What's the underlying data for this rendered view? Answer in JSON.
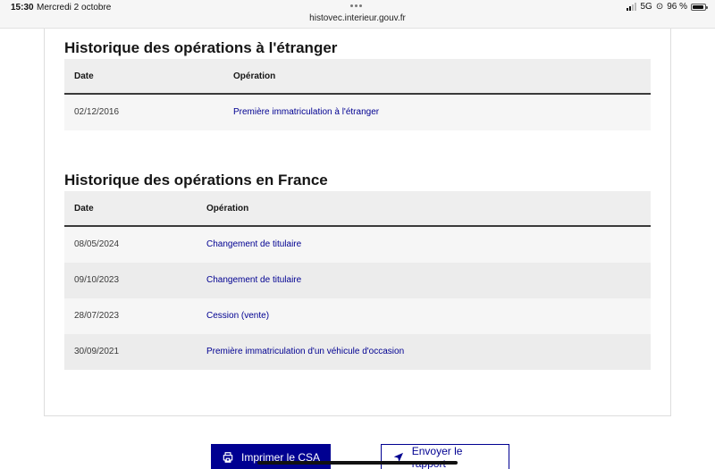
{
  "status_bar": {
    "time": "15:30",
    "date": "Mercredi 2 octobre",
    "url": "histovec.interieur.gouv.fr",
    "network": "5G",
    "battery": "96 %",
    "battery_level": 0.96
  },
  "abroad": {
    "title": "Historique des opérations à l'étranger",
    "col_date": "Date",
    "col_operation": "Opération",
    "rows": [
      {
        "date": "02/12/2016",
        "operation": "Première immatriculation à l'étranger"
      }
    ]
  },
  "france": {
    "title": "Historique des opérations en France",
    "col_date": "Date",
    "col_operation": "Opération",
    "rows": [
      {
        "date": "08/05/2024",
        "operation": "Changement de titulaire"
      },
      {
        "date": "09/10/2023",
        "operation": "Changement de titulaire"
      },
      {
        "date": "28/07/2023",
        "operation": "Cession (vente)"
      },
      {
        "date": "30/09/2021",
        "operation": "Première immatriculation d'un véhicule d'occasion"
      }
    ]
  },
  "actions": {
    "print_label": "Imprimer le CSA",
    "send_label": "Envoyer le rapport"
  },
  "colors": {
    "primary": "#000091",
    "header_bg": "#eeeeee",
    "row_light": "#f6f6f6",
    "row_dark": "#ececec"
  }
}
